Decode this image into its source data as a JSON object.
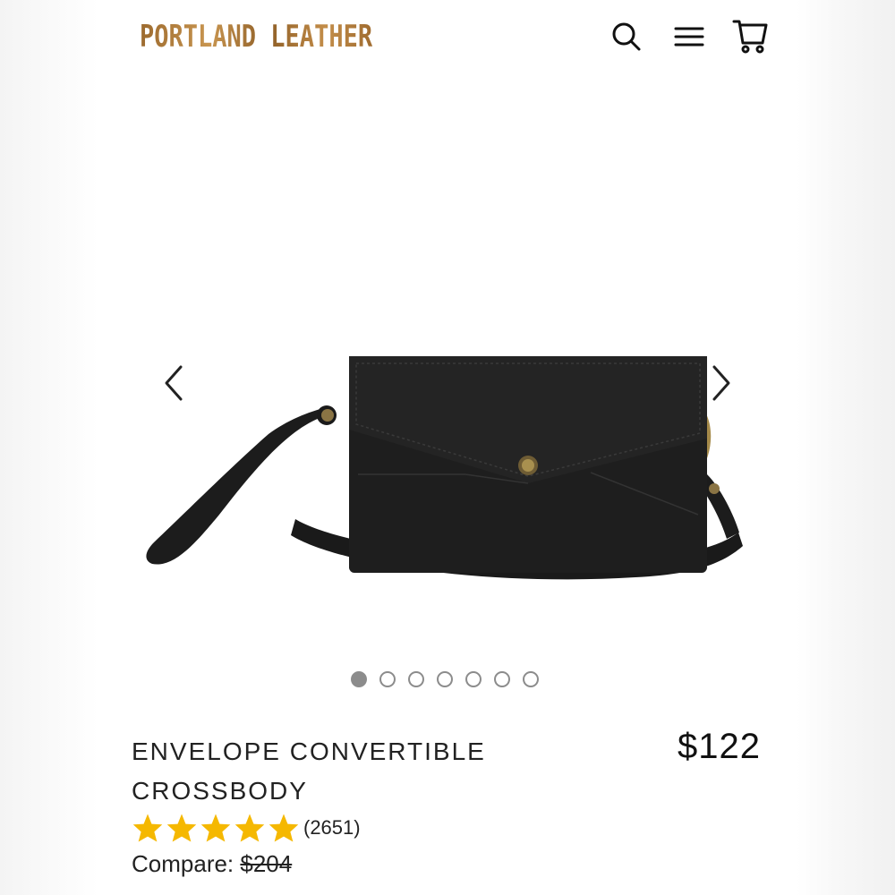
{
  "header": {
    "logo_text": "PORTLAND LEATHER",
    "icons": [
      "search-icon",
      "menu-icon",
      "cart-icon"
    ]
  },
  "gallery": {
    "image": "black-leather-envelope-crossbody-bag",
    "total_images": 7,
    "active_index": 0,
    "icons": [
      "chevron-left-icon",
      "chevron-right-icon"
    ]
  },
  "product": {
    "title": "ENVELOPE CONVERTIBLE CROSSBODY",
    "price": "$122",
    "rating_stars": 5,
    "review_count": "(2651)",
    "compare_label": "Compare:",
    "compare_price": "$204"
  },
  "colors": {
    "logo": "#b07a3a",
    "star": "#f5b800",
    "text": "#222222",
    "dot": "#8c8c8c"
  }
}
